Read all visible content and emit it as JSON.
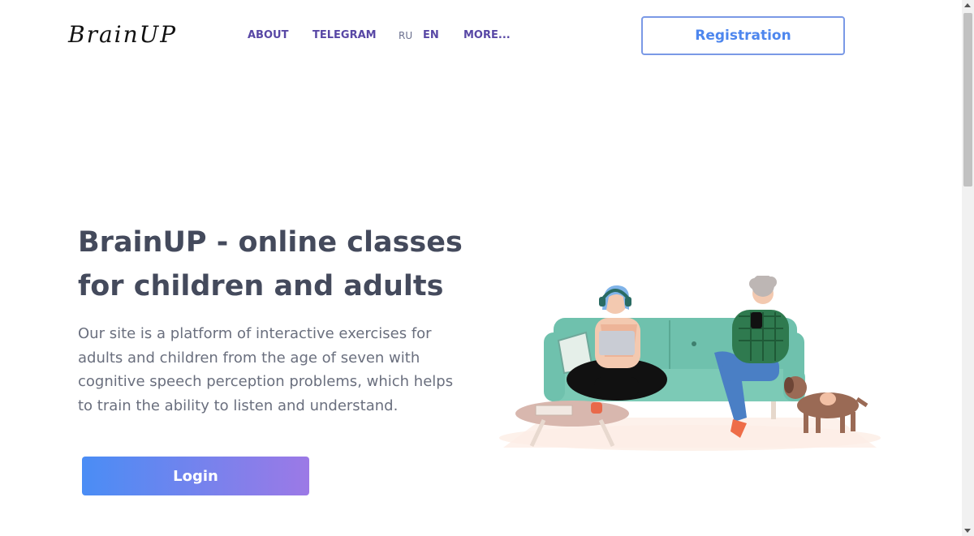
{
  "header": {
    "logo_text": "BrainUP",
    "nav": [
      {
        "label": "ABOUT"
      },
      {
        "label": "TELEGRAM"
      },
      {
        "label": "RU"
      },
      {
        "label": "EN"
      },
      {
        "label": "MORE..."
      }
    ],
    "registration_label": "Registration"
  },
  "hero": {
    "title_line1": "BrainUP - online classes",
    "title_line2": "for children and adults",
    "description": "Our site is a platform of interactive exercises for adults and children from the age of seven with cognitive speech perception problems, which helps to train the ability to listen and understand.",
    "login_label": "Login"
  },
  "colors": {
    "nav": "#5847a5",
    "accent_blue": "#4d86ee",
    "gradient_start": "#4a8df5",
    "gradient_end": "#9c79e6",
    "title": "#444a5c"
  },
  "illustration": {
    "icon": "family-on-couch-illustration"
  }
}
